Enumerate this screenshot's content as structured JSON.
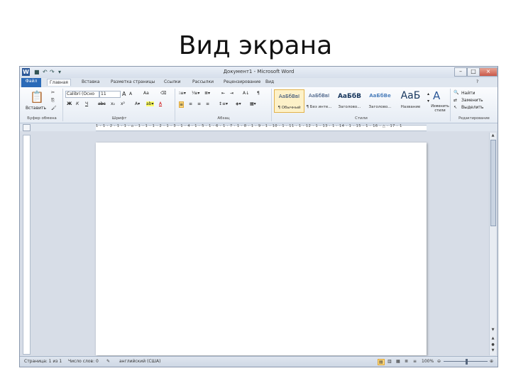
{
  "slide": {
    "title": "Вид экрана"
  },
  "window": {
    "title": "Документ1 - Microsoft Word",
    "app_icon": "W",
    "controls": {
      "minimize": "–",
      "maximize": "□",
      "close": "×"
    }
  },
  "tabs": [
    "Файл",
    "Главная",
    "Вставка",
    "Разметка страницы",
    "Ссылки",
    "Рассылки",
    "Рецензирование",
    "Вид"
  ],
  "ribbon": {
    "clipboard": {
      "label": "Буфер обмена",
      "paste": "Вставить"
    },
    "font": {
      "label": "Шрифт",
      "name": "Calibri (Осно",
      "size": "11",
      "bold": "Ж",
      "italic": "К",
      "underline": "Ч",
      "strike": "abc",
      "sub": "x₂",
      "sup": "x²",
      "grow": "A",
      "shrink": "A",
      "case": "Aa",
      "color": "A"
    },
    "paragraph": {
      "label": "Абзац",
      "pilcrow": "¶"
    },
    "styles": {
      "label": "Стили",
      "items": [
        {
          "preview": "АаБбВвІ",
          "name": "¶ Обычный"
        },
        {
          "preview": "АаБбВвІ",
          "name": "¶ Без инте..."
        },
        {
          "preview": "АаБбВ",
          "name": "Заголово..."
        },
        {
          "preview": "АаБбВе",
          "name": "Заголово..."
        },
        {
          "preview": "АаБ",
          "name": "Название"
        }
      ],
      "change": "Изменить стили"
    },
    "editing": {
      "label": "Редактирование",
      "find": "Найти",
      "replace": "Заменить",
      "select": "Выделить"
    }
  },
  "ruler": {
    "numbers": "1 · 1 · 2 · 1 · 1 · ⌂ · 1 · 1 · 1 · 2 · 1 · 3 · 1 · 4 · 1 · 5 · 1 · 6 · 1 · 7 · 1 · 8 · 1 · 9 · 1 · 10 · 1 · 11 · 1 · 12 · 1 · 13 · 1 · 14 · 1 · 15 · 1 · 16 · △ · 17 · 1"
  },
  "status": {
    "page": "Страница: 1 из 1",
    "words": "Число слов: 0",
    "lang": "английский (США)",
    "zoom": "100%"
  }
}
